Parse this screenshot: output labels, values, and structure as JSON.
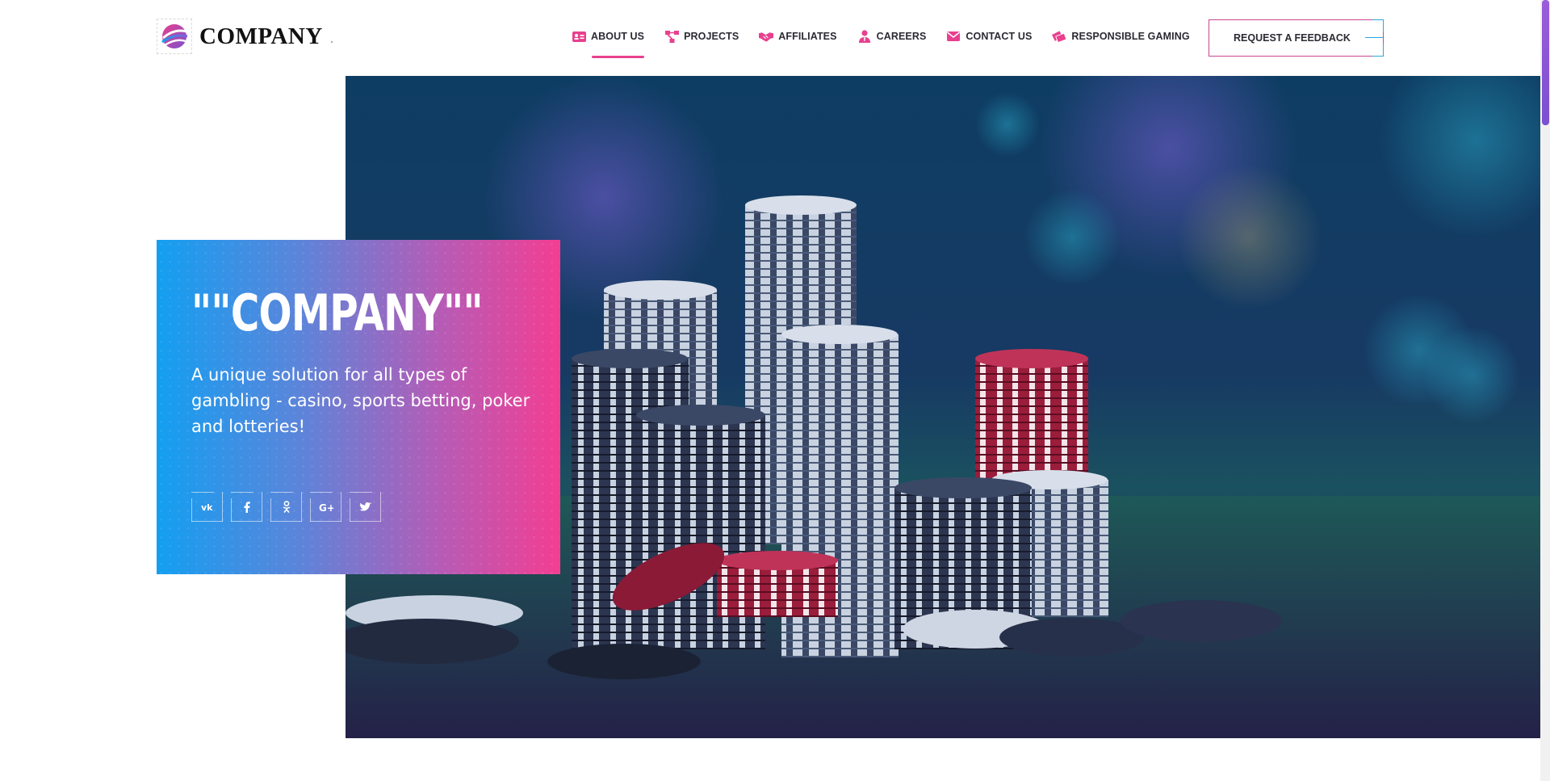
{
  "brand": {
    "name": "COMPANY",
    "logo_icon": "company-globe-logo",
    "colors": {
      "pink": "#e8408e",
      "blue": "#139ff1",
      "purple": "#8a5bd0",
      "dark": "#2b2b33"
    }
  },
  "nav": {
    "items": [
      {
        "label": "ABOUT US",
        "icon": "id-card-icon",
        "active": true
      },
      {
        "label": "PROJECTS",
        "icon": "sitemap-icon",
        "active": false
      },
      {
        "label": "AFFILIATES",
        "icon": "handshake-icon",
        "active": false
      },
      {
        "label": "CAREERS",
        "icon": "user-tie-icon",
        "active": false
      },
      {
        "label": "CONTACT US",
        "icon": "envelope-icon",
        "active": false
      },
      {
        "label": "RESPONSIBLE GAMING",
        "icon": "tickets-icon",
        "active": false
      }
    ],
    "cta_label": "REQUEST A FEEDBACK"
  },
  "hero": {
    "title": "\"\"COMPANY\"\"",
    "subtitle": "A unique solution for all types of gambling - casino, sports betting, poker and lotteries!",
    "image": "poker-chips-photo",
    "socials": [
      {
        "name": "vk",
        "icon": "vk-icon"
      },
      {
        "name": "facebook",
        "icon": "facebook-icon"
      },
      {
        "name": "odnoklassniki",
        "icon": "odnoklassniki-icon"
      },
      {
        "name": "google-plus",
        "icon": "google-plus-icon"
      },
      {
        "name": "twitter",
        "icon": "twitter-icon"
      }
    ]
  }
}
